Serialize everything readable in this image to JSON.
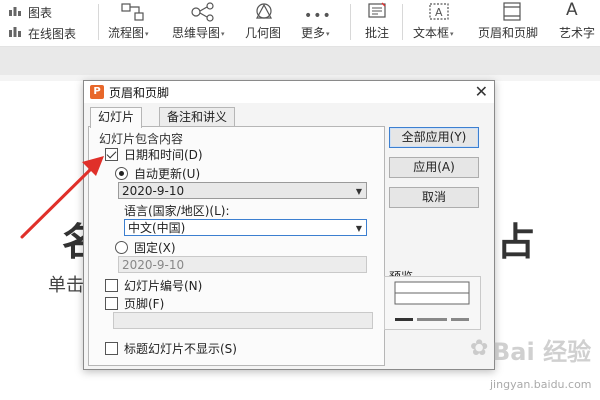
{
  "ribbon": {
    "left_items": [
      "图表",
      "在线图表"
    ],
    "items": [
      {
        "label": "流程图",
        "dropdown": true
      },
      {
        "label": "思维导图",
        "dropdown": true
      },
      {
        "label": "几何图",
        "dropdown": false
      },
      {
        "label": "更多",
        "dropdown": true
      },
      {
        "label": "批注",
        "dropdown": false
      },
      {
        "label": "文本框",
        "dropdown": true
      },
      {
        "label": "页眉和页脚",
        "dropdown": false
      },
      {
        "label": "艺术字",
        "dropdown": false
      }
    ]
  },
  "slide": {
    "big_char": "名",
    "subtitle_char": "单击",
    "right_char": "占"
  },
  "dialog": {
    "title": "页眉和页脚",
    "close_glyph": "✕",
    "tabs": [
      "幻灯片",
      "备注和讲义"
    ],
    "active_tab": 0,
    "group_label": "幻灯片包含内容",
    "date_time": {
      "label": "日期和时间(D)",
      "checked": true
    },
    "auto_update": {
      "label": "自动更新(U)",
      "selected": true,
      "value": "2020-9-10"
    },
    "language": {
      "label": "语言(国家/地区)(L):",
      "value": "中文(中国)"
    },
    "fixed": {
      "label": "固定(X)",
      "selected": false,
      "value": "2020-9-10"
    },
    "slide_number": {
      "label": "幻灯片编号(N)",
      "checked": false
    },
    "footer": {
      "label": "页脚(F)",
      "checked": false,
      "value": ""
    },
    "hide_on_title": {
      "label": "标题幻灯片不显示(S)",
      "checked": false
    },
    "buttons": {
      "apply_all": "全部应用(Y)",
      "apply": "应用(A)",
      "cancel": "取消"
    },
    "preview_label": "预览"
  },
  "watermark": {
    "text": "Bai 经验",
    "url": "jingyan.baidu.com"
  },
  "colors": {
    "annotation_arrow": "#e0302a",
    "office_orange": "#e8672a",
    "focus_blue": "#3c7fd0"
  }
}
